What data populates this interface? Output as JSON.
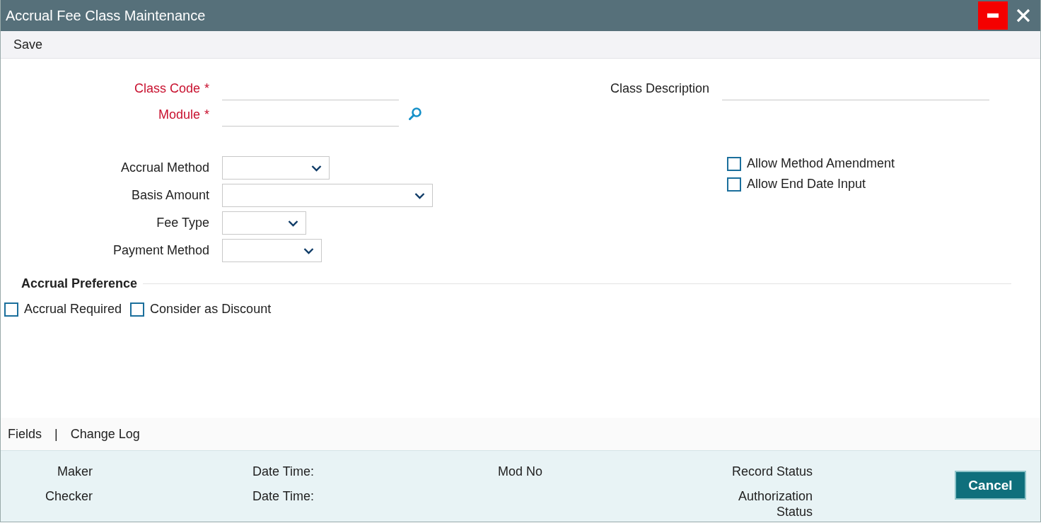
{
  "window": {
    "title": "Accrual Fee Class Maintenance"
  },
  "toolbar": {
    "actions": [
      "Save"
    ]
  },
  "main_fields": [
    {
      "label": "Class Code",
      "required": true,
      "marker": "*",
      "kind": "text"
    },
    {
      "label": "Module",
      "required": true,
      "marker": "*",
      "kind": "lookup"
    }
  ],
  "description_field": {
    "label": "Class Description",
    "required": false
  },
  "selects": [
    {
      "label": "Accrual Method"
    },
    {
      "label": "Basis Amount"
    },
    {
      "label": "Fee Type"
    },
    {
      "label": "Payment Method"
    }
  ],
  "options": [
    {
      "label": "Allow Method Amendment",
      "checked": false
    },
    {
      "label": "Allow End Date Input",
      "checked": false
    }
  ],
  "accrual_preference": {
    "title": "Accrual Preference",
    "options": [
      {
        "label": "Accrual Required",
        "checked": false
      },
      {
        "label": "Consider as Discount",
        "checked": false
      }
    ]
  },
  "footer_tabs": {
    "items": [
      "Fields",
      "Change Log"
    ],
    "separator": "|"
  },
  "audit": {
    "columns": [
      [
        "Maker",
        "Checker"
      ],
      [
        "Date Time:",
        "Date Time:"
      ],
      [
        "Mod No"
      ],
      [
        "Record Status",
        "Authorization Status"
      ]
    ]
  },
  "cancel_button": "Cancel"
}
